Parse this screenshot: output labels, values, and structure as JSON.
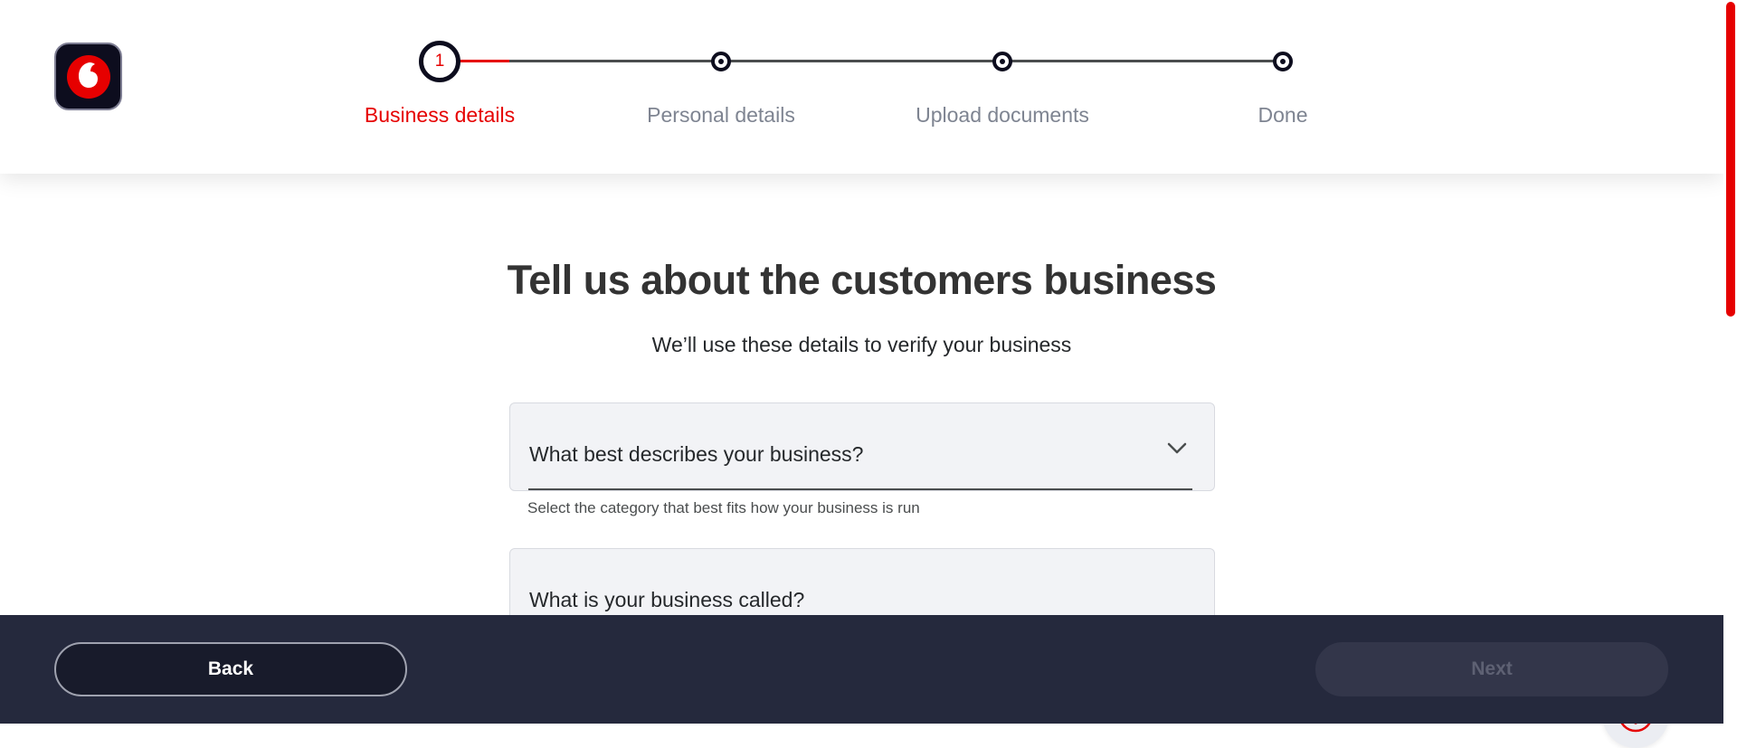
{
  "brand": {
    "logo_icon": "vodafone-speechmark-icon",
    "accent_color": "#e60000",
    "dark_color": "#0d0d1e"
  },
  "stepper": {
    "progress": 0.083,
    "steps": [
      {
        "number": "1",
        "label": "Business details",
        "state": "active"
      },
      {
        "label": "Personal details",
        "state": "pending"
      },
      {
        "label": "Upload documents",
        "state": "pending"
      },
      {
        "label": "Done",
        "state": "pending"
      }
    ]
  },
  "main": {
    "title": "Tell us about the customers business",
    "subtitle": "We’ll use these details to verify your business",
    "fields": [
      {
        "label": "What best describes your business?",
        "helper": "Select the category that best fits how your business is run",
        "type": "select",
        "icon": "chevron-down-icon"
      },
      {
        "label": "What is your business called?",
        "type": "text"
      }
    ],
    "help_icon": "question-circle-icon"
  },
  "footer": {
    "back_label": "Back",
    "next_label": "Next",
    "next_enabled": false
  }
}
